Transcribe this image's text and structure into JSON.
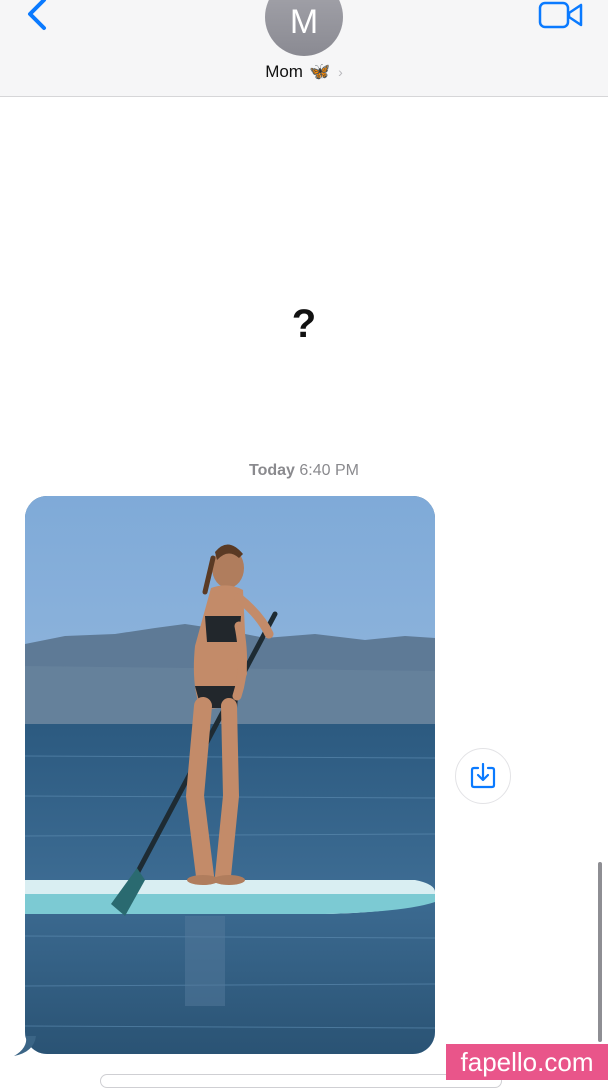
{
  "header": {
    "avatar_initial": "M",
    "contact_name": "Mom",
    "contact_emoji": "🦋",
    "chevron": "›",
    "back_icon": "chevron-left-icon",
    "facetime_icon": "video-camera-icon"
  },
  "messages": {
    "received_text": "?",
    "timestamp_day": "Today",
    "timestamp_time": "6:40 PM",
    "photo_description_icon": "photo-attachment"
  },
  "actions": {
    "save_icon": "save-to-photos-icon"
  },
  "watermark": {
    "text": "fapello.com"
  },
  "colors": {
    "accent": "#0a7aff",
    "header_bg": "#f6f6f7",
    "timestamp": "#8a8a8e",
    "watermark_bg": "#e9558a"
  }
}
